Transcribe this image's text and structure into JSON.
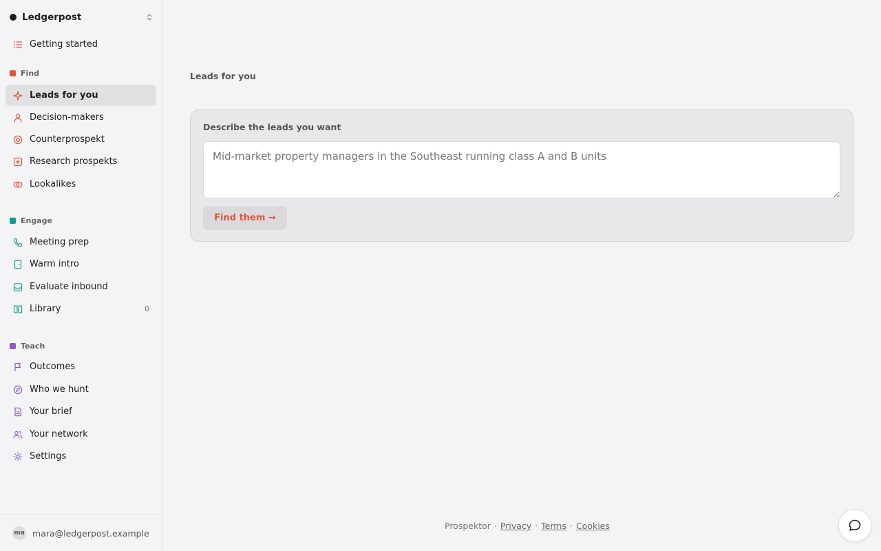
{
  "workspace": {
    "name": "Ledgerpost"
  },
  "nav": {
    "getting_started": "Getting started",
    "find": {
      "title": "Find",
      "color": "#e2533b",
      "items": [
        {
          "label": "Leads for you",
          "icon": "sparkle-icon",
          "active": true
        },
        {
          "label": "Decision-makers",
          "icon": "person-icon"
        },
        {
          "label": "Counterprospekt",
          "icon": "target-icon"
        },
        {
          "label": "Research prospekts",
          "icon": "plus-square-icon"
        },
        {
          "label": "Lookalikes",
          "icon": "overlapping-circles-icon"
        }
      ]
    },
    "engage": {
      "title": "Engage",
      "color": "#199a8e",
      "items": [
        {
          "label": "Meeting prep",
          "icon": "phone-icon"
        },
        {
          "label": "Warm intro",
          "icon": "door-icon"
        },
        {
          "label": "Evaluate inbound",
          "icon": "inbox-icon"
        },
        {
          "label": "Library",
          "icon": "columns-icon",
          "count": "0"
        }
      ]
    },
    "teach": {
      "title": "Teach",
      "color": "#8a5cc4",
      "items": [
        {
          "label": "Outcomes",
          "icon": "flag-icon"
        },
        {
          "label": "Who we hunt",
          "icon": "compass-icon"
        },
        {
          "label": "Your brief",
          "icon": "document-icon"
        },
        {
          "label": "Your network",
          "icon": "people-icon"
        },
        {
          "label": "Settings",
          "icon": "gear-icon"
        }
      ]
    }
  },
  "user": {
    "initials": "ma",
    "email": "mara@ledgerpost.example"
  },
  "main": {
    "heading": "Leads for you",
    "card": {
      "label": "Describe the leads you want",
      "placeholder": "Mid-market property managers in the Southeast running class A and B units",
      "button": "Find them →"
    }
  },
  "footer": {
    "brand": "Prospektor",
    "links": [
      "Privacy",
      "Terms",
      "Cookies"
    ]
  }
}
